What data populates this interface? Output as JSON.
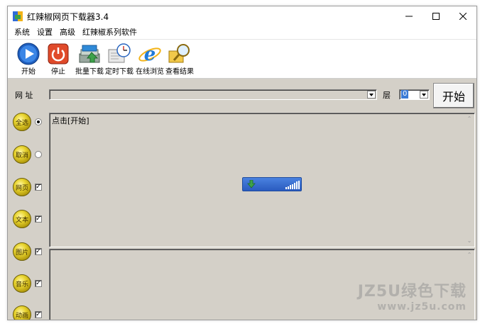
{
  "window": {
    "title": "红辣椒网页下载器3.4",
    "controls": [
      "minimize",
      "maximize",
      "close"
    ]
  },
  "menu": {
    "items": [
      "系统",
      "设置",
      "高级",
      "红辣椒系列软件"
    ]
  },
  "toolbar": {
    "buttons": [
      {
        "label": "开始",
        "icon": "play-icon"
      },
      {
        "label": "停止",
        "icon": "power-stop-icon"
      },
      {
        "label": "批量下载",
        "icon": "batch-download-icon"
      },
      {
        "label": "定时下载",
        "icon": "scheduled-download-icon"
      },
      {
        "label": "在线浏览",
        "icon": "internet-explorer-icon"
      },
      {
        "label": "查看结果",
        "icon": "magnifier-icon"
      }
    ]
  },
  "address": {
    "label": "网 址",
    "value": "",
    "layer_label": "层",
    "layer_value": "0",
    "start_button": "开始"
  },
  "options": [
    {
      "label": "全选",
      "control": "radio",
      "checked": true
    },
    {
      "label": "取消",
      "control": "radio",
      "checked": false
    },
    {
      "label": "网页",
      "control": "checkbox",
      "checked": true
    },
    {
      "label": "文本",
      "control": "checkbox",
      "checked": true
    },
    {
      "label": "图片",
      "control": "checkbox",
      "checked": true
    },
    {
      "label": "音乐",
      "control": "checkbox",
      "checked": true
    },
    {
      "label": "动画",
      "control": "checkbox",
      "checked": true
    }
  ],
  "content": {
    "hint": "点击[开始]"
  },
  "watermark": {
    "line1": "JZ5U绿色下载",
    "line2": "www.jz5u.com"
  },
  "colors": {
    "panel": "#d4d0c8",
    "progress": "#3a6fd0",
    "accent_green": "#3da24a"
  }
}
